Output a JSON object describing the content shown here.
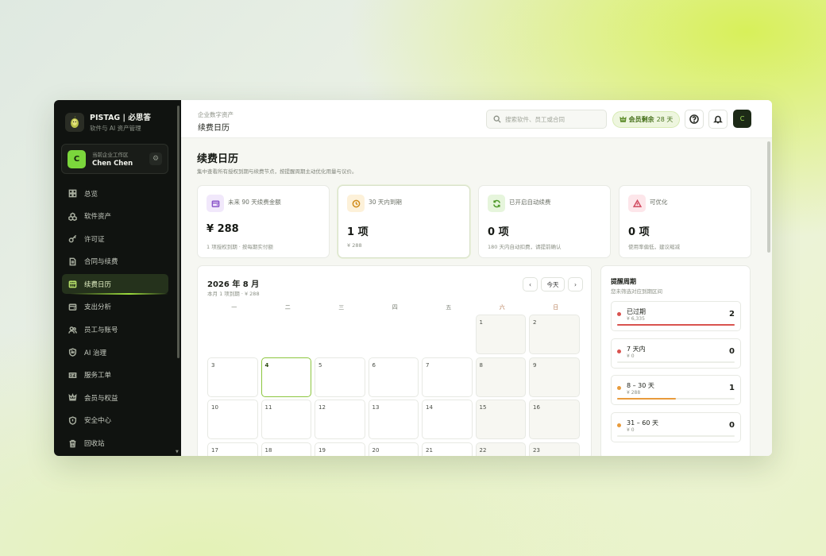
{
  "brand": {
    "name": "PISTAG | 必思答",
    "subtitle": "软件与 AI 资产管理"
  },
  "workspace": {
    "label": "当前企业工作区",
    "user": "Chen Chen",
    "avatar": "C"
  },
  "sidebar": {
    "items": [
      {
        "label": "总览",
        "icon": "grid-icon"
      },
      {
        "label": "软件资产",
        "icon": "cubes-icon"
      },
      {
        "label": "许可证",
        "icon": "key-icon"
      },
      {
        "label": "合同与续费",
        "icon": "document-icon"
      },
      {
        "label": "续费日历",
        "icon": "calendar-icon",
        "active": true
      },
      {
        "label": "支出分析",
        "icon": "wallet-icon"
      },
      {
        "label": "员工与账号",
        "icon": "users-icon"
      },
      {
        "label": "AI 治理",
        "icon": "shield-ai-icon"
      },
      {
        "label": "服务工单",
        "icon": "ticket-icon"
      },
      {
        "label": "会员与权益",
        "icon": "crown-icon"
      },
      {
        "label": "安全中心",
        "icon": "shield-icon"
      },
      {
        "label": "回收站",
        "icon": "trash-icon"
      }
    ]
  },
  "header": {
    "breadcrumb_parent": "企业数字资产",
    "breadcrumb_title": "续费日历",
    "search_placeholder": "搜索软件、员工或合同",
    "vip_label": "会员剩余",
    "vip_days": "28 天",
    "user_avatar": "C"
  },
  "page": {
    "title": "续费日历",
    "description": "集中查看所有授权到期与续费节点，按提醒周期主动优化用量与议价。"
  },
  "cards": [
    {
      "label": "未来 90 天续费金额",
      "value": "¥ 288",
      "sub": "1 项授权到期 · 按每期实付额",
      "icon": "wallet-icon",
      "tint": "#f1e8fb",
      "stroke": "#8a55c9"
    },
    {
      "label": "30 天内到期",
      "value": "1 项",
      "sub": "¥ 288",
      "icon": "clock-icon",
      "tint": "#fdf1d9",
      "stroke": "#d08a17"
    },
    {
      "label": "已开启自动续费",
      "value": "0 项",
      "sub": "180 天内自动扣费，请提前确认",
      "icon": "refresh-icon",
      "tint": "#e6f5dc",
      "stroke": "#4f9a2a"
    },
    {
      "label": "可优化",
      "value": "0 项",
      "sub": "使用率偏低，建议缩减",
      "icon": "warning-icon",
      "tint": "#fde6ea",
      "stroke": "#d14a5f"
    }
  ],
  "calendar": {
    "month": "2026 年 8 月",
    "summary": "本月 1 项到期 · ¥ 288",
    "today_label": "今天",
    "weekdays": [
      "一",
      "二",
      "三",
      "四",
      "五",
      "六",
      "日"
    ],
    "first_weekday_index": 5,
    "days_in_month": 31,
    "today": 4
  },
  "reminders": {
    "title": "提醒周期",
    "subtitle": "您未筛选对应到期区间",
    "items": [
      {
        "label": "已过期",
        "amount": "¥ 6,335",
        "count": "2",
        "color": "#d9534f",
        "fill": 1.0
      },
      {
        "label": "7 天内",
        "amount": "¥ 0",
        "count": "0",
        "color": "#d9534f",
        "fill": 0
      },
      {
        "label": "8 – 30 天",
        "amount": "¥ 288",
        "count": "1",
        "color": "#e89b3c",
        "fill": 0.5
      },
      {
        "label": "31 – 60 天",
        "amount": "¥ 0",
        "count": "0",
        "color": "#e89b3c",
        "fill": 0
      }
    ]
  }
}
